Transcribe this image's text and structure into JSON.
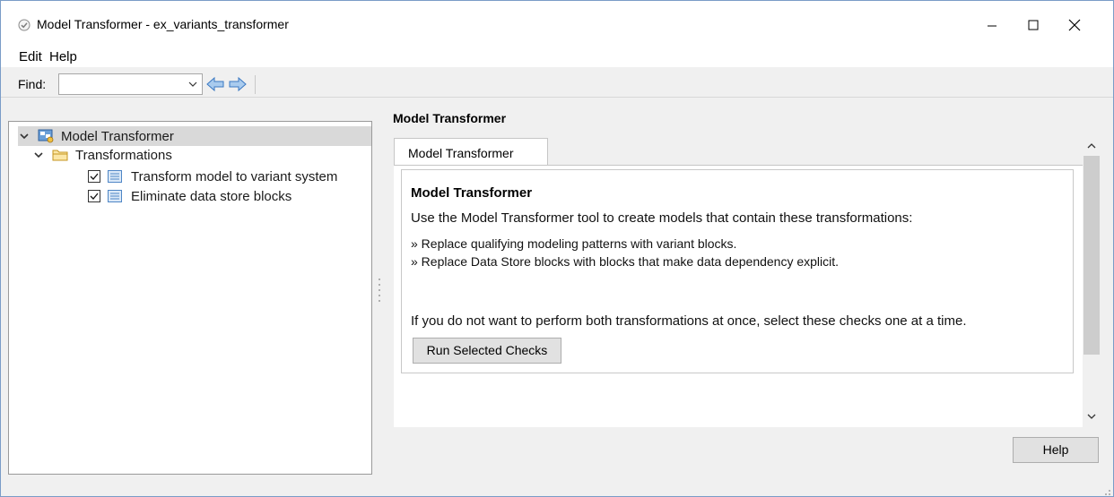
{
  "window": {
    "title": "Model Transformer - ex_variants_transformer",
    "controls": {
      "minimize": "minimize",
      "maximize": "maximize",
      "close": "close"
    }
  },
  "menu": {
    "items": [
      "Edit",
      "Help"
    ]
  },
  "find": {
    "label": "Find:",
    "value": "",
    "placeholder": ""
  },
  "tree": {
    "root": {
      "label": "Model Transformer",
      "icon": "model-advisor-icon",
      "expanded": true,
      "selected": true
    },
    "folder": {
      "label": "Transformations",
      "icon": "folder-icon",
      "expanded": true
    },
    "checks": [
      {
        "label": "Transform model to variant system",
        "checked": true,
        "icon": "check-list-icon"
      },
      {
        "label": "Eliminate data store blocks",
        "checked": true,
        "icon": "check-list-icon"
      }
    ]
  },
  "panel": {
    "title": "Model Transformer",
    "tab_label": "Model Transformer",
    "heading": "Model Transformer",
    "description": "Use the Model Transformer tool to create models that contain these transformations:",
    "bullets": [
      "» Replace qualifying modeling patterns with variant blocks.",
      "» Replace Data Store blocks with blocks that make data dependency explicit."
    ],
    "note": "If you do not want to perform both transformations at once, select these checks one at a time.",
    "run_button": "Run Selected Checks"
  },
  "footer": {
    "help_button": "Help"
  },
  "colors": {
    "accent": "#2f6db5",
    "selection": "#d9d9d9",
    "folder": "#e8b84a"
  }
}
